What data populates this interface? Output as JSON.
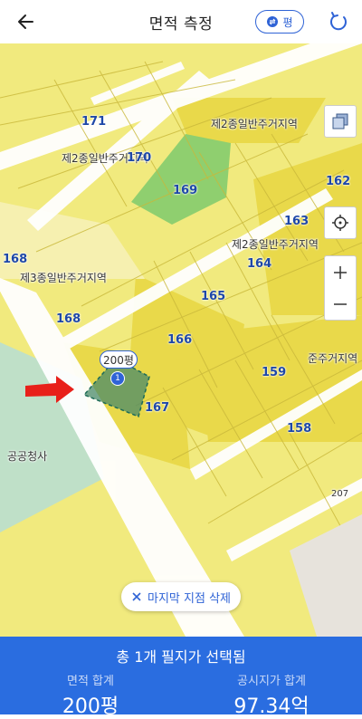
{
  "header": {
    "title": "면적 측정",
    "unit_toggle_label": "평"
  },
  "map": {
    "parcel_labels": [
      "171",
      "170",
      "169",
      "162",
      "163",
      "164",
      "168",
      "168",
      "165",
      "166",
      "159",
      "158",
      "167",
      "207"
    ],
    "zone_labels": [
      "제2종일반주거지역",
      "제2종일반주거지역",
      "제2종일반주거지역",
      "제3종일반주거지역",
      "준주거지역",
      "공공청사"
    ],
    "measure": {
      "area_label": "200평",
      "point_number": "1"
    },
    "undo_button_label": "마지막 지점 삭제",
    "colors": {
      "residential": "#f1ea7e",
      "general_residential": "#e9d94a",
      "road": "#ffffff",
      "park": "#8fcf6f",
      "public": "#bfe0c8",
      "measure_fill": "#4a8a6a",
      "accent": "#2f63d6",
      "arrow": "#e8201a"
    }
  },
  "footer": {
    "summary": "총 1개 필지가 선택됨",
    "area_label": "면적 합계",
    "area_value": "200평",
    "price_label": "공시지가 합계",
    "price_value": "97.34억"
  }
}
